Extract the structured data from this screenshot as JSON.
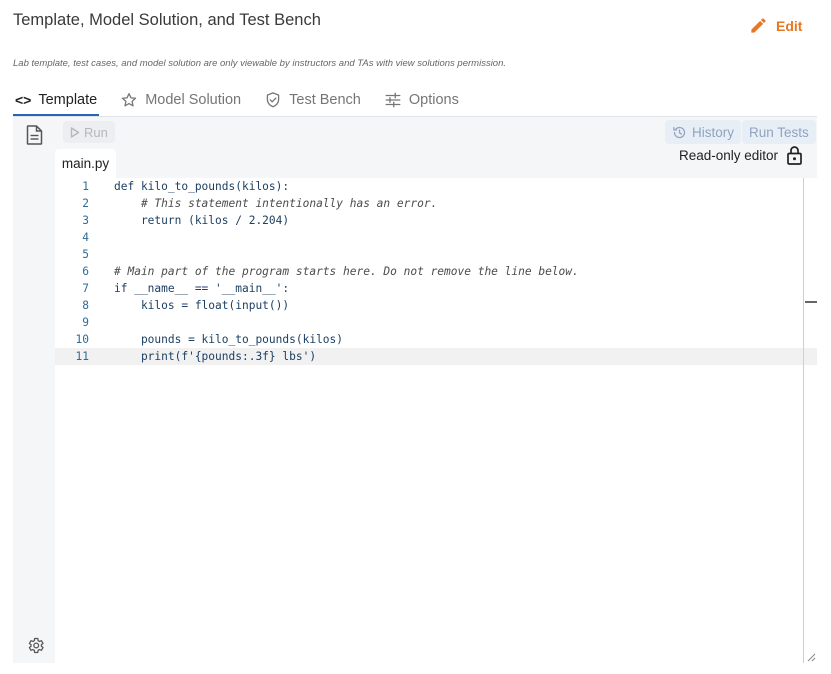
{
  "header": {
    "title": "Template, Model Solution, and Test Bench",
    "edit_label": "Edit",
    "notice": "Lab template, test cases, and model solution are only viewable by instructors and TAs with view solutions permission."
  },
  "tabs": [
    {
      "label": "Template",
      "icon": "code-icon",
      "active": true
    },
    {
      "label": "Model Solution",
      "icon": "star-icon",
      "active": false
    },
    {
      "label": "Test Bench",
      "icon": "shield-check-icon",
      "active": false
    },
    {
      "label": "Options",
      "icon": "sliders-icon",
      "active": false
    }
  ],
  "toolbar": {
    "run_label": "Run",
    "history_label": "History",
    "run_tests_label": "Run Tests"
  },
  "editor": {
    "file_name": "main.py",
    "readonly_label": "Read-only editor",
    "current_line": 11,
    "lines": [
      {
        "n": "1",
        "text": "def kilo_to_pounds(kilos):"
      },
      {
        "n": "2",
        "text": "    # This statement intentionally has an error."
      },
      {
        "n": "3",
        "text": "    return (kilos / 2.204)"
      },
      {
        "n": "4",
        "text": ""
      },
      {
        "n": "5",
        "text": ""
      },
      {
        "n": "6",
        "text": "# Main part of the program starts here. Do not remove the line below."
      },
      {
        "n": "7",
        "text": "if __name__ == '__main__':"
      },
      {
        "n": "8",
        "text": "    kilos = float(input())"
      },
      {
        "n": "9",
        "text": ""
      },
      {
        "n": "10",
        "text": "    pounds = kilo_to_pounds(kilos)"
      },
      {
        "n": "11",
        "text": "    print(f'{pounds:.3f} lbs')"
      }
    ]
  },
  "colors": {
    "accent": "#e87722",
    "tab_underline": "#2a62b5",
    "line_number": "#2f6b97"
  }
}
